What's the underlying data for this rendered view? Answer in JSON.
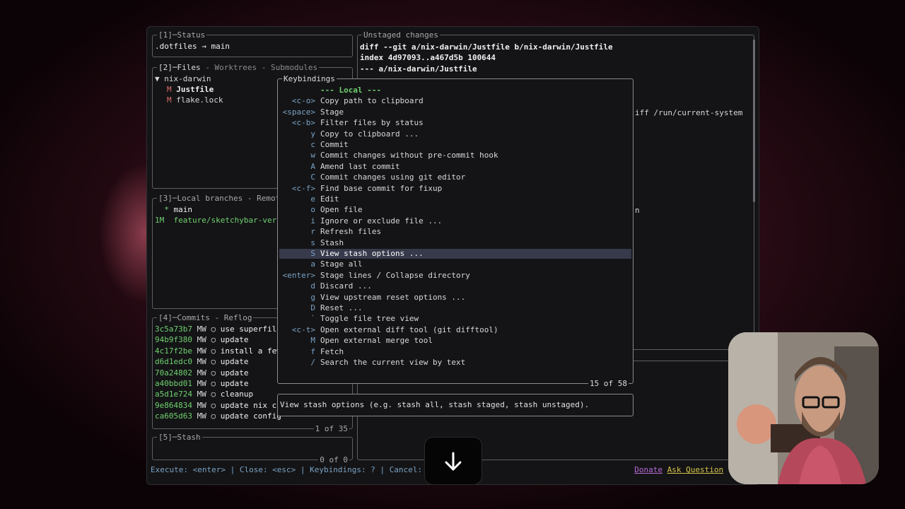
{
  "status_pane": {
    "title": "[1]─Status",
    "line": ".dotfiles → main"
  },
  "files_pane": {
    "title_active": "[2]─Files",
    "title_rest": " - Worktrees - Submodules",
    "dir": "▼ nix-darwin",
    "files": [
      {
        "status": "M",
        "name": "Justfile"
      },
      {
        "status": "M",
        "name": "flake.lock"
      }
    ]
  },
  "branches_pane": {
    "title": "[3]─Local branches - Remot",
    "branches": [
      {
        "prefix": "  * ",
        "name": "main"
      },
      {
        "prefix": "1M  ",
        "name": "feature/sketchybar-vert"
      }
    ]
  },
  "commits_pane": {
    "title": "[4]─Commits - Reflog",
    "count": "1 of 35",
    "commits": [
      {
        "hash": "3c5a73b7",
        "author": "MW",
        "msg": "use superfile"
      },
      {
        "hash": "94b9f380",
        "author": "MW",
        "msg": "update"
      },
      {
        "hash": "4c17f2be",
        "author": "MW",
        "msg": "install a few"
      },
      {
        "hash": "d6d1edc0",
        "author": "MW",
        "msg": "update"
      },
      {
        "hash": "70a24802",
        "author": "MW",
        "msg": "update"
      },
      {
        "hash": "a40bbd01",
        "author": "MW",
        "msg": "update"
      },
      {
        "hash": "a5d1e724",
        "author": "MW",
        "msg": "cleanup"
      },
      {
        "hash": "9e864834",
        "author": "MW",
        "msg": "update nix co"
      },
      {
        "hash": "ca605d63",
        "author": "MW",
        "msg": "update config"
      }
    ]
  },
  "stash_pane": {
    "title": "[5]─Stash",
    "count": "0 of 0"
  },
  "diff_pane": {
    "title": "Unstaged changes",
    "lines": [
      "diff --git a/nix-darwin/Justfile b/nix-darwin/Justfile",
      "index 4d97093..a467d5b 100644",
      "--- a/nix-darwin/Justfile"
    ],
    "partial_1": "iff /run/current-system",
    "partial_2": "n"
  },
  "keybindings": {
    "title": "Keybindings",
    "counter": "15 of 58",
    "header": "--- Local ---",
    "items": [
      {
        "key": "<c-o>",
        "desc": "Copy path to clipboard"
      },
      {
        "key": "<space>",
        "desc": "Stage"
      },
      {
        "key": "<c-b>",
        "desc": "Filter files by status"
      },
      {
        "key": "y",
        "desc": "Copy to clipboard ..."
      },
      {
        "key": "c",
        "desc": "Commit"
      },
      {
        "key": "w",
        "desc": "Commit changes without pre-commit hook"
      },
      {
        "key": "A",
        "desc": "Amend last commit"
      },
      {
        "key": "C",
        "desc": "Commit changes using git editor"
      },
      {
        "key": "<c-f>",
        "desc": "Find base commit for fixup"
      },
      {
        "key": "e",
        "desc": "Edit"
      },
      {
        "key": "o",
        "desc": "Open file"
      },
      {
        "key": "i",
        "desc": "Ignore or exclude file ..."
      },
      {
        "key": "r",
        "desc": "Refresh files"
      },
      {
        "key": "s",
        "desc": "Stash"
      },
      {
        "key": "S",
        "desc": "View stash options ..."
      },
      {
        "key": "a",
        "desc": "Stage all"
      },
      {
        "key": "<enter>",
        "desc": "Stage lines / Collapse directory"
      },
      {
        "key": "d",
        "desc": "Discard ..."
      },
      {
        "key": "g",
        "desc": "View upstream reset options ..."
      },
      {
        "key": "D",
        "desc": "Reset ..."
      },
      {
        "key": "`",
        "desc": "Toggle file tree view"
      },
      {
        "key": "<c-t>",
        "desc": "Open external diff tool (git difftool)"
      },
      {
        "key": "M",
        "desc": "Open external merge tool"
      },
      {
        "key": "f",
        "desc": "Fetch"
      },
      {
        "key": "/",
        "desc": "Search the current view by text"
      }
    ],
    "selected_index": 14
  },
  "tooltip": "View stash options (e.g. stash all, stash staged, stash unstaged).",
  "statusbar": {
    "left": "Execute: <enter> | Close: <esc> | Keybindings: ? | Cancel: <es",
    "donate": "Donate",
    "ask": "Ask Question",
    "version": "0."
  },
  "scroll_icon": "arrow-down-icon",
  "colors": {
    "hash": "#6fd06f",
    "key": "#7aa2c4",
    "modified": "#d96a6a",
    "selection": "#363a4b"
  }
}
